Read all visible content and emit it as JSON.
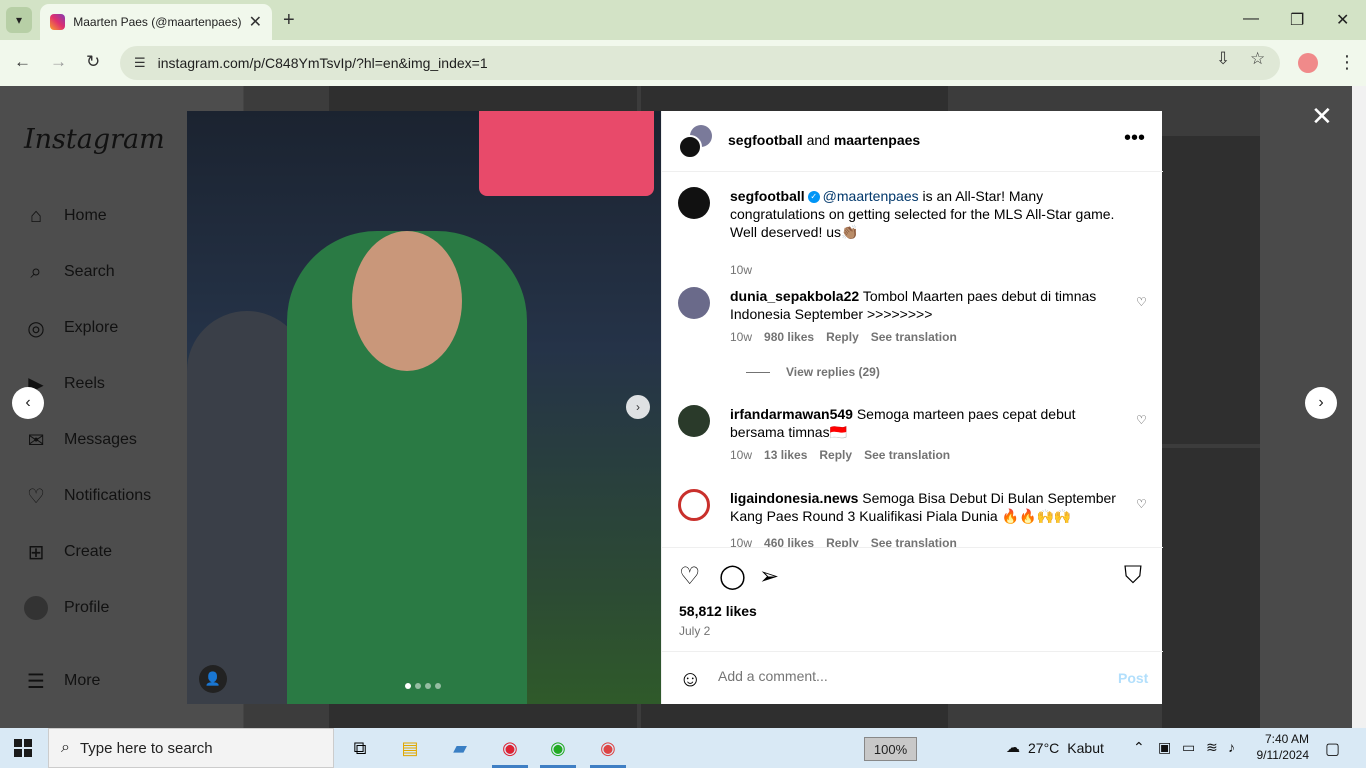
{
  "browser": {
    "tab_title": "Maarten Paes (@maartenpaes)",
    "url": "instagram.com/p/C848YmTsvIp/?hl=en&img_index=1"
  },
  "sidebar": {
    "logo": "Instagram",
    "items": [
      {
        "label": "Home",
        "icon": "⌂"
      },
      {
        "label": "Search",
        "icon": "⌕"
      },
      {
        "label": "Explore",
        "icon": "◎"
      },
      {
        "label": "Reels",
        "icon": "▶"
      },
      {
        "label": "Messages",
        "icon": "✉"
      },
      {
        "label": "Notifications",
        "icon": "♡"
      },
      {
        "label": "Create",
        "icon": "⊞"
      },
      {
        "label": "Profile",
        "icon": ""
      },
      {
        "label": "More",
        "icon": "☰"
      }
    ]
  },
  "post": {
    "header_user1": "segfootball",
    "header_and": "and",
    "header_user2": "maartenpaes",
    "caption": {
      "user": "segfootball",
      "mention": "@maartenpaes",
      "text": " is an All-Star! Many congratulations on getting selected for the MLS All-Star game. Well deserved! us👏🏽",
      "time": "10w"
    },
    "comments": [
      {
        "user": "dunia_sepakbola22",
        "text": "Tombol Maarten paes debut di timnas Indonesia September >>>>>>>>",
        "time": "10w",
        "likes": "980 likes",
        "reply": "Reply",
        "translate": "See translation"
      },
      {
        "user": "irfandarmawan549",
        "text": "Semoga marteen paes cepat debut bersama timnas🇮🇩",
        "time": "10w",
        "likes": "13 likes",
        "reply": "Reply",
        "translate": "See translation"
      },
      {
        "user": "ligaindonesia.news",
        "text": "Semoga Bisa Debut Di Bulan September Kang Paes Round 3 Kualifikasi Piala Dunia 🔥🔥🙌🙌",
        "time": "10w",
        "likes": "460 likes",
        "reply": "Reply",
        "translate": "See translation"
      }
    ],
    "view_replies": "View replies (29)",
    "likes": "58,812 likes",
    "date": "July 2",
    "comment_placeholder": "Add a comment...",
    "post_label": "Post"
  },
  "taskbar": {
    "search_placeholder": "Type here to search",
    "zoom": "100%",
    "weather_temp": "27°C",
    "weather_text": "Kabut",
    "time": "7:40 AM",
    "date": "9/11/2024"
  }
}
